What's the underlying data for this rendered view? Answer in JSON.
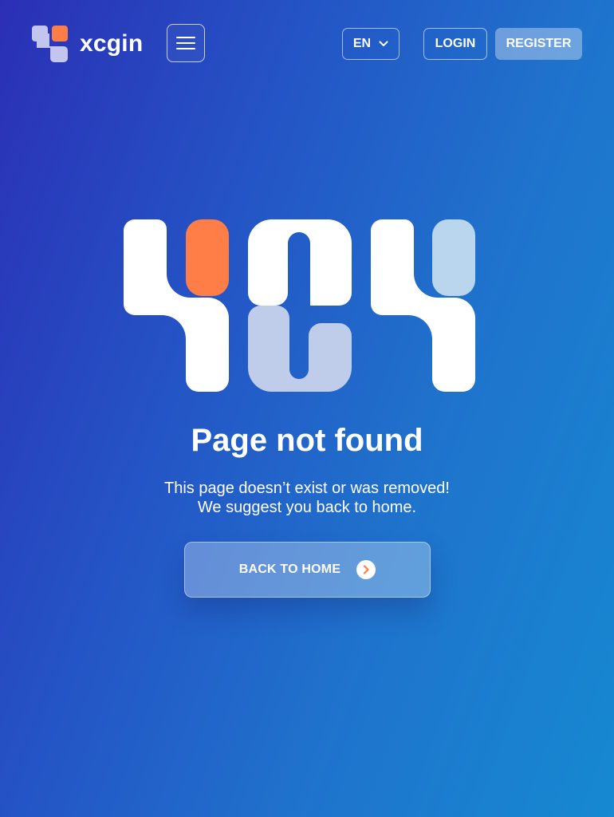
{
  "header": {
    "brand": "xcgin",
    "language": "EN",
    "login_label": "LOGIN",
    "register_label": "REGISTER"
  },
  "icons": {
    "logo": "xcgin-logo-icon",
    "menu": "hamburger-menu-icon",
    "language_dropdown": "chevron-down-icon",
    "back_button": "chevron-right-icon",
    "illustration": "404-illustration"
  },
  "main": {
    "title": "Page not found",
    "subtitle_line1": "This page doesn’t exist or was removed!",
    "subtitle_line2": "We suggest you back to home.",
    "button_label": "BACK TO HOME"
  },
  "colors": {
    "background_start": "#2b2fb5",
    "background_end": "#1689d2",
    "accent": "#ff7d46",
    "light_blue": "#bad5ee",
    "lavender": "#c0cdea"
  }
}
